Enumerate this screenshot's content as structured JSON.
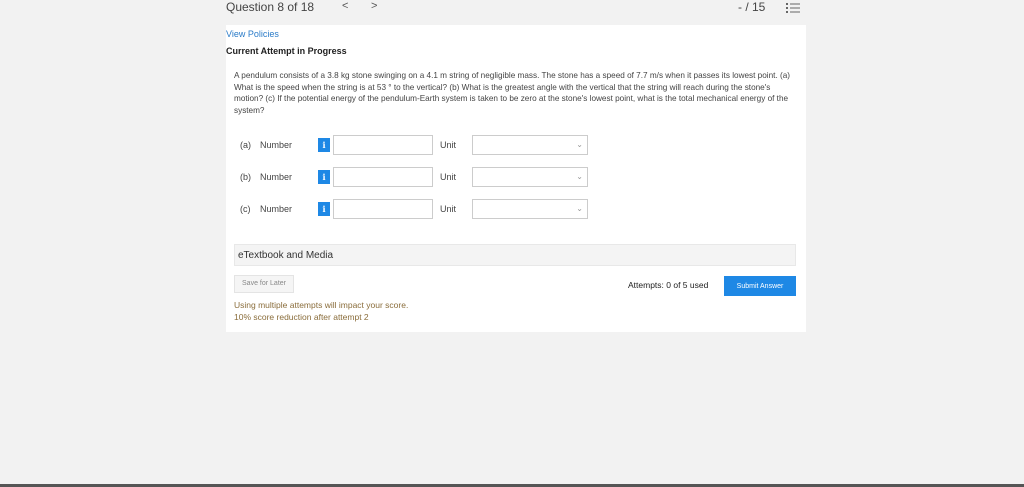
{
  "header": {
    "question_label": "Question 8 of 18",
    "prev_glyph": "<",
    "next_glyph": ">",
    "score": "- / 15"
  },
  "links": {
    "view_policies": "View Policies",
    "current_attempt": "Current Attempt in Progress"
  },
  "question_text": "A pendulum consists of a 3.8 kg stone swinging on a 4.1 m string of negligible mass. The stone has a speed of 7.7 m/s when it passes its lowest point. (a) What is the speed when the string is at 53 ° to the vertical? (b) What is the greatest angle with the vertical that the string will reach during the stone's motion? (c) If the potential energy of the pendulum-Earth system is taken to be zero at the stone's lowest point, what is the total mechanical energy of the system?",
  "answers": [
    {
      "part": "(a)",
      "number_label": "Number",
      "info_glyph": "i",
      "value": "",
      "unit_label": "Unit",
      "unit_value": ""
    },
    {
      "part": "(b)",
      "number_label": "Number",
      "info_glyph": "i",
      "value": "",
      "unit_label": "Unit",
      "unit_value": ""
    },
    {
      "part": "(c)",
      "number_label": "Number",
      "info_glyph": "i",
      "value": "",
      "unit_label": "Unit",
      "unit_value": ""
    }
  ],
  "etextbook_label": "eTextbook and Media",
  "footer": {
    "save_later": "Save for Later",
    "attempts": "Attempts: 0 of 5 used",
    "submit": "Submit Answer",
    "note_1": "Using multiple attempts will impact your score.",
    "note_2": "10% score reduction after attempt 2"
  },
  "colors": {
    "accent": "#1e88e5",
    "link": "#2a7bc8",
    "note": "#8a6d3b",
    "background": "#f2f2f2"
  },
  "icons": {
    "list": "list-icon",
    "info": "info-icon",
    "dropdown": "chevron-down-icon"
  }
}
